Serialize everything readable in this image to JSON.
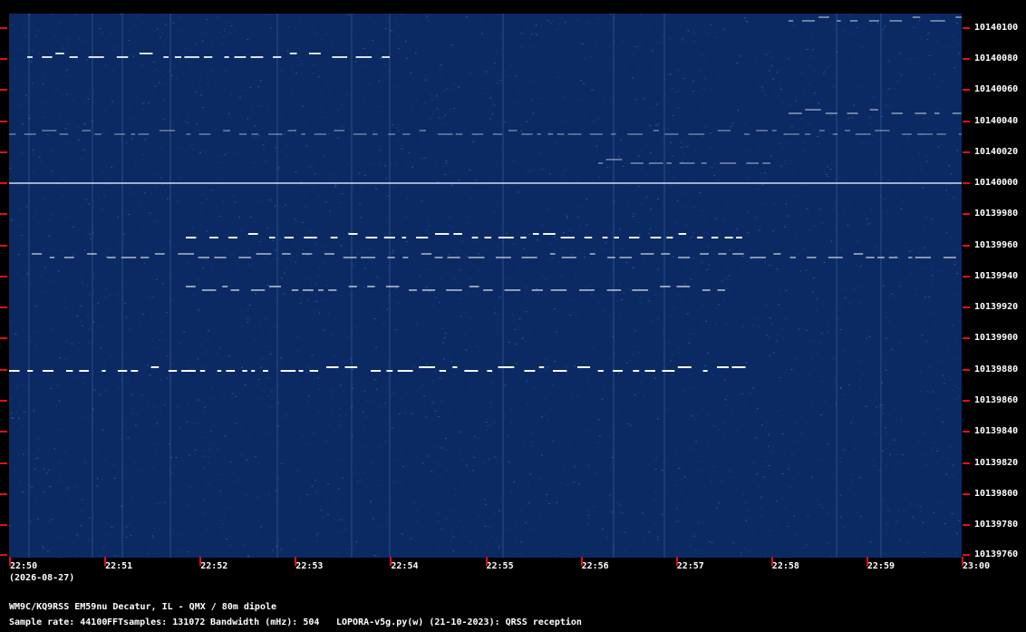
{
  "y_labels": [
    "10140100",
    "10140080",
    "10140060",
    "10140040",
    "10140020",
    "10140000",
    "10139980",
    "10139960",
    "10139940",
    "10139920",
    "10139900",
    "10139880",
    "10139860",
    "10139840",
    "10139820",
    "10139800",
    "10139780",
    "10139760"
  ],
  "x_labels": [
    "22:50",
    "22:51",
    "22:52",
    "22:53",
    "22:54",
    "22:55",
    "22:56",
    "22:57",
    "22:58",
    "22:59",
    "23:00"
  ],
  "date": "(2026-08-27)",
  "station": "WM9C/KQ9RSS EM59nu Decatur, IL - QMX / 80m dipole",
  "sample_rate": "Sample rate: 44100",
  "fft_samples": "FFTsamples: 131072",
  "bandwidth": "Bandwidth (mHz): 504",
  "software": "LOPORA-v5g.py(w) (21-10-2023): QRSS reception",
  "colors": {
    "background": "#0b2a63",
    "tick": "#e01010",
    "signal": "#ffffff"
  }
}
